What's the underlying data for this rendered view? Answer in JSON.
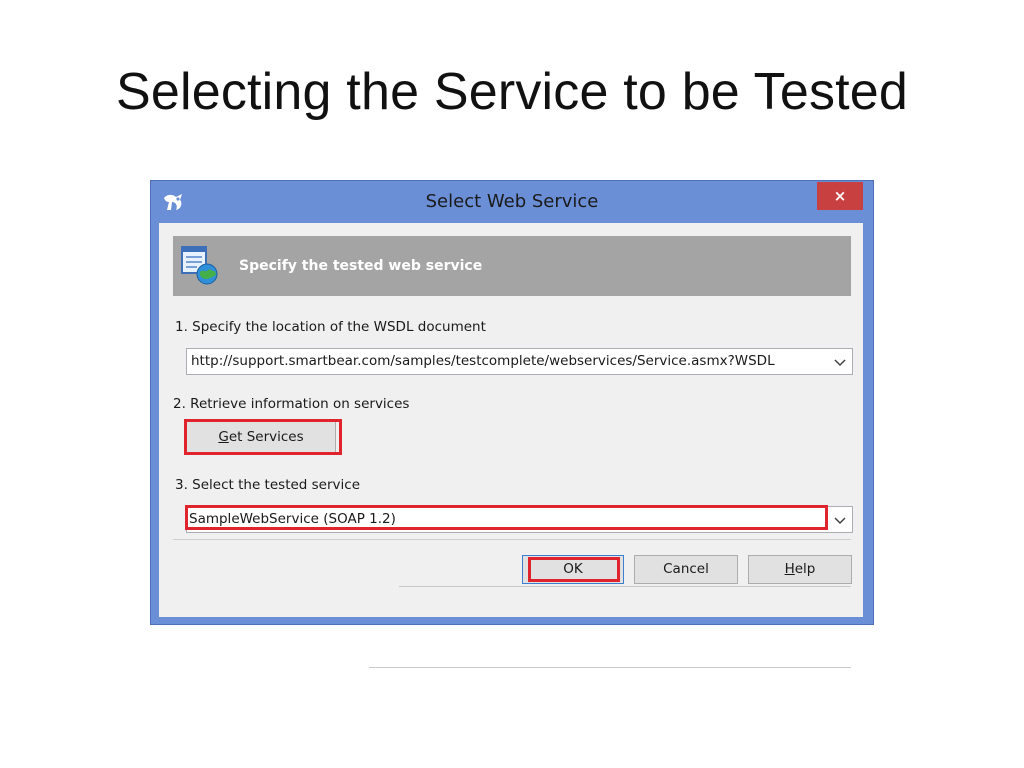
{
  "slide": {
    "title": "Selecting the Service to be Tested"
  },
  "dialog": {
    "title": "Select Web Service",
    "close_label": "×",
    "banner_text": "Specify the tested web service",
    "step1": {
      "label": "1. Specify the location of the WSDL document",
      "value": "http://support.smartbear.com/samples/testcomplete/webservices/Service.asmx?WSDL"
    },
    "step2": {
      "label": "2. Retrieve information on services",
      "button_mnemonic": "G",
      "button_rest": "et Services"
    },
    "step3": {
      "label": "3. Select the tested service",
      "value": "SampleWebService (SOAP 1.2)"
    },
    "buttons": {
      "ok": "OK",
      "cancel": "Cancel",
      "help_mnemonic": "H",
      "help_rest": "elp"
    }
  },
  "colors": {
    "highlight": "#e0242e",
    "titlebar": "#6b8fd6",
    "close_button": "#c94040",
    "banner": "#a4a4a4"
  },
  "icons": {
    "app": "testcomplete-app-icon",
    "banner": "web-service-globe-icon",
    "dropdown": "chevron-down-icon"
  }
}
